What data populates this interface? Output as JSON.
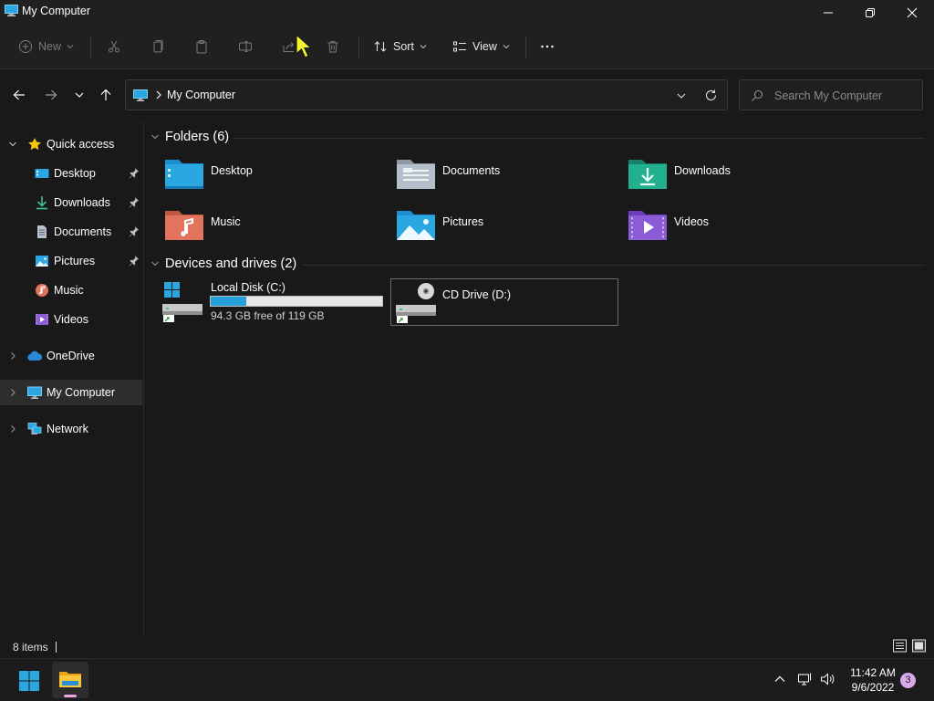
{
  "window": {
    "title": "My Computer"
  },
  "toolbar": {
    "new_label": "New",
    "sort_label": "Sort",
    "view_label": "View"
  },
  "address": {
    "path": "My Computer",
    "search_placeholder": "Search My Computer"
  },
  "sidebar": {
    "quick_access": "Quick access",
    "items": [
      {
        "label": "Desktop",
        "pinned": true
      },
      {
        "label": "Downloads",
        "pinned": true
      },
      {
        "label": "Documents",
        "pinned": true
      },
      {
        "label": "Pictures",
        "pinned": true
      },
      {
        "label": "Music",
        "pinned": false
      },
      {
        "label": "Videos",
        "pinned": false
      }
    ],
    "onedrive": "OneDrive",
    "my_computer": "My Computer",
    "network": "Network"
  },
  "content": {
    "folders_header": "Folders (6)",
    "folders": [
      {
        "label": "Desktop",
        "icon": "desktop-folder-icon"
      },
      {
        "label": "Documents",
        "icon": "documents-folder-icon"
      },
      {
        "label": "Downloads",
        "icon": "downloads-folder-icon"
      },
      {
        "label": "Music",
        "icon": "music-folder-icon"
      },
      {
        "label": "Pictures",
        "icon": "pictures-folder-icon"
      },
      {
        "label": "Videos",
        "icon": "videos-folder-icon"
      }
    ],
    "drives_header": "Devices and drives (2)",
    "drives": [
      {
        "label": "Local Disk (C:)",
        "free_text": "94.3 GB free of 119 GB",
        "used_fraction": 0.21
      },
      {
        "label": "CD Drive (D:)"
      }
    ]
  },
  "status": {
    "item_count": "8 items"
  },
  "taskbar": {
    "time": "11:42 AM",
    "date": "9/6/2022",
    "notification_count": "3"
  },
  "colors": {
    "accent": "#26a0da",
    "background": "#191919",
    "chrome": "#202020"
  }
}
